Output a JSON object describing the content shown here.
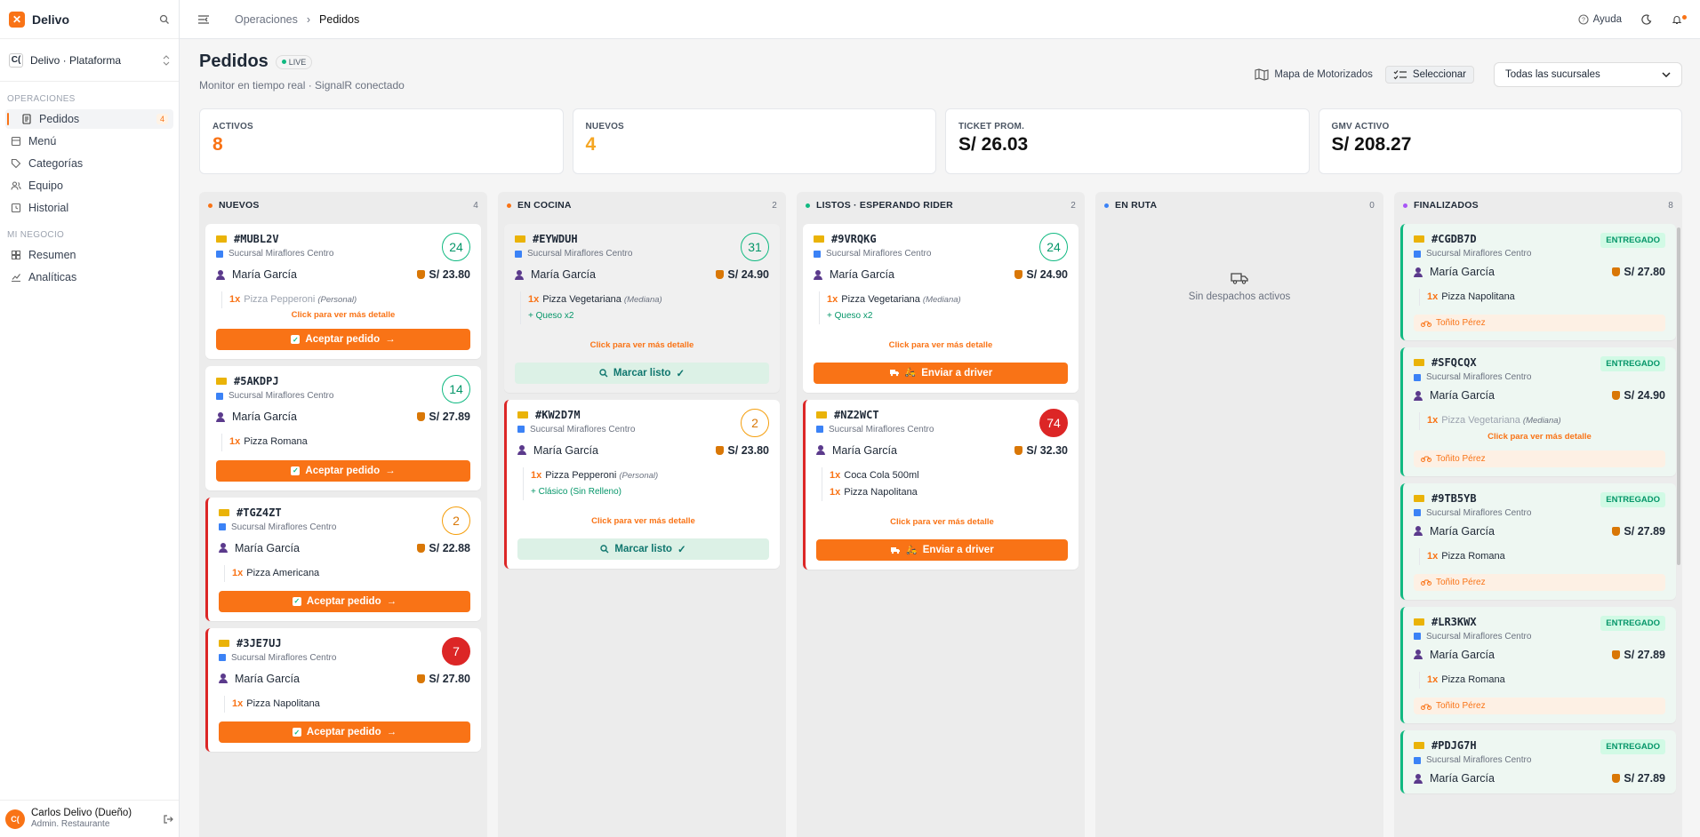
{
  "app": {
    "name": "Delivo",
    "platform": "Delivo · Plataforma",
    "platform_avatar": "C("
  },
  "sidebar": {
    "sections": [
      {
        "label": "OPERACIONES",
        "items": [
          {
            "label": "Pedidos",
            "icon": "receipt-icon",
            "badge": "4",
            "active": true
          },
          {
            "label": "Menú",
            "icon": "book-icon"
          },
          {
            "label": "Categorías",
            "icon": "tag-icon"
          },
          {
            "label": "Equipo",
            "icon": "users-icon"
          },
          {
            "label": "Historial",
            "icon": "history-icon"
          }
        ]
      },
      {
        "label": "MI NEGOCIO",
        "items": [
          {
            "label": "Resumen",
            "icon": "grid-icon"
          },
          {
            "label": "Analíticas",
            "icon": "chart-icon"
          }
        ]
      }
    ],
    "user": {
      "avatar": "C(",
      "name": "Carlos Delivo (Dueño)",
      "role": "Admin. Restaurante"
    }
  },
  "topbar": {
    "breadcrumb": [
      "Operaciones",
      "Pedidos"
    ],
    "help": "Ayuda"
  },
  "page": {
    "title": "Pedidos",
    "live": "LIVE",
    "subtitle": "Monitor en tiempo real · SignalR conectado",
    "map_label": "Mapa de Motorizados",
    "select_label": "Seleccionar",
    "branch_select": "Todas las sucursales"
  },
  "stats": [
    {
      "label": "ACTIVOS",
      "value": "8",
      "color": "#f97316"
    },
    {
      "label": "NUEVOS",
      "value": "4",
      "color": "#f5a623"
    },
    {
      "label": "TICKET PROM.",
      "value": "S/ 26.03",
      "color": "#111111"
    },
    {
      "label": "GMV ACTIVO",
      "value": "S/ 208.27",
      "color": "#111111"
    }
  ],
  "columns": [
    {
      "title": "NUEVOS",
      "count": "4",
      "dot": "#f97316",
      "cards": [
        {
          "code": "#MUBL2V",
          "branch": "Sucursal Miraflores Centro",
          "customer": "María García",
          "price": "S/ 23.80",
          "timer": "24",
          "timer_state": "ok",
          "items": [
            {
              "qty": "1x",
              "name": "Pizza Pepperoni",
              "opt": "(Personal)",
              "faded": true
            }
          ],
          "more": "Click para ver más detalle",
          "action": "Aceptar pedido"
        },
        {
          "code": "#5AKDPJ",
          "branch": "Sucursal Miraflores Centro",
          "customer": "María García",
          "price": "S/ 27.89",
          "timer": "14",
          "timer_state": "ok",
          "items": [
            {
              "qty": "1x",
              "name": "Pizza Romana"
            }
          ],
          "action": "Aceptar pedido"
        },
        {
          "code": "#TGZ4ZT",
          "branch": "Sucursal Miraflores Centro",
          "customer": "María García",
          "price": "S/ 22.88",
          "timer": "2",
          "timer_state": "warn",
          "urgent": true,
          "items": [
            {
              "qty": "1x",
              "name": "Pizza Americana"
            }
          ],
          "action": "Aceptar pedido"
        },
        {
          "code": "#3JE7UJ",
          "branch": "Sucursal Miraflores Centro",
          "customer": "María García",
          "price": "S/ 27.80",
          "timer": "7",
          "timer_state": "late",
          "urgent": true,
          "items": [
            {
              "qty": "1x",
              "name": "Pizza Napolitana"
            }
          ],
          "action": "Aceptar pedido"
        }
      ]
    },
    {
      "title": "EN COCINA",
      "count": "2",
      "dot": "#f97316",
      "cards": [
        {
          "code": "#EYWDUH",
          "branch": "Sucursal Miraflores Centro",
          "customer": "María García",
          "price": "S/ 24.90",
          "timer": "31",
          "timer_state": "ok",
          "cook": true,
          "items": [
            {
              "qty": "1x",
              "name": "Pizza Vegetariana",
              "opt": "(Mediana)",
              "extra": "+ Queso x2"
            }
          ],
          "more": "Click para ver más detalle",
          "action": "Marcar listo",
          "action_type": "ready"
        },
        {
          "code": "#KW2D7M",
          "branch": "Sucursal Miraflores Centro",
          "customer": "María García",
          "price": "S/ 23.80",
          "timer": "2",
          "timer_state": "warn",
          "urgent": true,
          "items": [
            {
              "qty": "1x",
              "name": "Pizza Pepperoni",
              "opt": "(Personal)",
              "extra": "+ Clásico (Sin Relleno)"
            }
          ],
          "more": "Click para ver más detalle",
          "action": "Marcar listo",
          "action_type": "ready"
        }
      ]
    },
    {
      "title": "LISTOS · ESPERANDO RIDER",
      "count": "2",
      "dot": "#10b981",
      "cards": [
        {
          "code": "#9VRQKG",
          "branch": "Sucursal Miraflores Centro",
          "customer": "María García",
          "price": "S/ 24.90",
          "timer": "24",
          "timer_state": "ok",
          "items": [
            {
              "qty": "1x",
              "name": "Pizza Vegetariana",
              "opt": "(Mediana)",
              "extra": "+ Queso x2"
            }
          ],
          "more": "Click para ver más detalle",
          "action": "Enviar a driver",
          "action_type": "driver"
        },
        {
          "code": "#NZ2WCT",
          "branch": "Sucursal Miraflores Centro",
          "customer": "María García",
          "price": "S/ 32.30",
          "timer": "74",
          "timer_state": "late",
          "urgent": true,
          "items": [
            {
              "qty": "1x",
              "name": "Coca Cola 500ml"
            },
            {
              "qty": "1x",
              "name": "Pizza Napolitana"
            }
          ],
          "more": "Click para ver más detalle",
          "action": "Enviar a driver",
          "action_type": "driver"
        }
      ]
    },
    {
      "title": "EN RUTA",
      "count": "0",
      "dot": "#3b82f6",
      "empty": "Sin despachos activos",
      "cards": []
    },
    {
      "title": "FINALIZADOS",
      "count": "8",
      "dot": "#a855f7",
      "cards": [
        {
          "code": "#CGDB7D",
          "branch": "Sucursal Miraflores Centro",
          "customer": "María García",
          "price": "S/ 27.80",
          "status": "ENTREGADO",
          "done": true,
          "items": [
            {
              "qty": "1x",
              "name": "Pizza Napolitana"
            }
          ],
          "rider": "Toñito Pérez"
        },
        {
          "code": "#SFQCQX",
          "branch": "Sucursal Miraflores Centro",
          "customer": "María García",
          "price": "S/ 24.90",
          "status": "ENTREGADO",
          "done": true,
          "items": [
            {
              "qty": "1x",
              "name": "Pizza Vegetariana",
              "opt": "(Mediana)",
              "faded": true
            }
          ],
          "more": "Click para ver más detalle",
          "rider": "Toñito Pérez"
        },
        {
          "code": "#9TB5YB",
          "branch": "Sucursal Miraflores Centro",
          "customer": "María García",
          "price": "S/ 27.89",
          "status": "ENTREGADO",
          "done": true,
          "items": [
            {
              "qty": "1x",
              "name": "Pizza Romana"
            }
          ],
          "rider": "Toñito Pérez"
        },
        {
          "code": "#LR3KWX",
          "branch": "Sucursal Miraflores Centro",
          "customer": "María García",
          "price": "S/ 27.89",
          "status": "ENTREGADO",
          "done": true,
          "items": [
            {
              "qty": "1x",
              "name": "Pizza Romana"
            }
          ],
          "rider": "Toñito Pérez"
        },
        {
          "code": "#PDJG7H",
          "branch": "Sucursal Miraflores Centro",
          "customer": "María García",
          "price": "S/ 27.89",
          "status": "ENTREGADO",
          "done": true,
          "items": [],
          "rider": ""
        }
      ]
    }
  ]
}
